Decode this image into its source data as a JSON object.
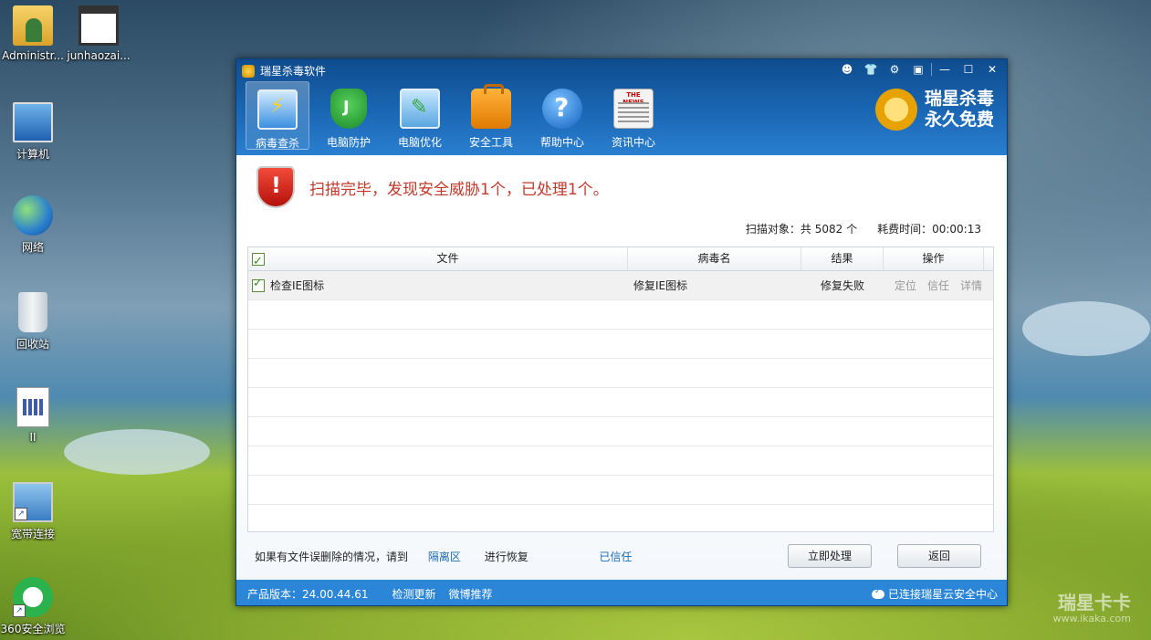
{
  "desktop": {
    "icons": [
      {
        "label": "Administr..."
      },
      {
        "label": "junhaozai..."
      },
      {
        "label": "计算机"
      },
      {
        "label": "网络"
      },
      {
        "label": "回收站"
      },
      {
        "label": "II"
      },
      {
        "label": "宽带连接"
      },
      {
        "label": "360安全浏览"
      }
    ],
    "watermark": {
      "title": "瑞星卡卡",
      "url": "www.ikaka.com"
    }
  },
  "window": {
    "title": "瑞星杀毒软件",
    "controls": [
      "user-icon",
      "skin-icon",
      "settings-icon",
      "menu-icon",
      "minimize-icon",
      "maximize-icon",
      "close-icon"
    ],
    "nav": [
      {
        "label": "病毒查杀",
        "icon": "virus-scan-icon",
        "active": true
      },
      {
        "label": "电脑防护",
        "icon": "shield-icon"
      },
      {
        "label": "电脑优化",
        "icon": "optimize-icon"
      },
      {
        "label": "安全工具",
        "icon": "toolbox-icon"
      },
      {
        "label": "帮助中心",
        "icon": "help-icon"
      },
      {
        "label": "资讯中心",
        "icon": "news-icon"
      }
    ],
    "brand": {
      "line1": "瑞星杀毒",
      "line2": "永久免费"
    }
  },
  "scan": {
    "message": "扫描完毕，发现安全威胁1个，已处理1个。",
    "objects": "扫描对象：共 5082 个",
    "elapsed": "耗费时间：00:00:13",
    "columns": {
      "file": "文件",
      "virus": "病毒名",
      "result": "结果",
      "action": "操作"
    },
    "rows": [
      {
        "file": "检查IE图标",
        "virus": "修复IE图标",
        "result": "修复失败",
        "actions": [
          "定位",
          "信任",
          "详情"
        ]
      }
    ]
  },
  "footer": {
    "hint_prefix": "如果有文件误删除的情况，请到",
    "quarantine_link": "隔离区",
    "hint_suffix": "进行恢复",
    "trusted_link": "已信任",
    "process_button": "立即处理",
    "back_button": "返回"
  },
  "status": {
    "version": "产品版本：24.00.44.61",
    "check_update": "检测更新",
    "weibo": "微博推荐",
    "cloud": "已连接瑞星云安全中心"
  },
  "colors": {
    "titlebar": "#1a67b4",
    "statusbar": "#2b86d8",
    "alert": "#c0392b",
    "link": "#1a6ab0"
  }
}
